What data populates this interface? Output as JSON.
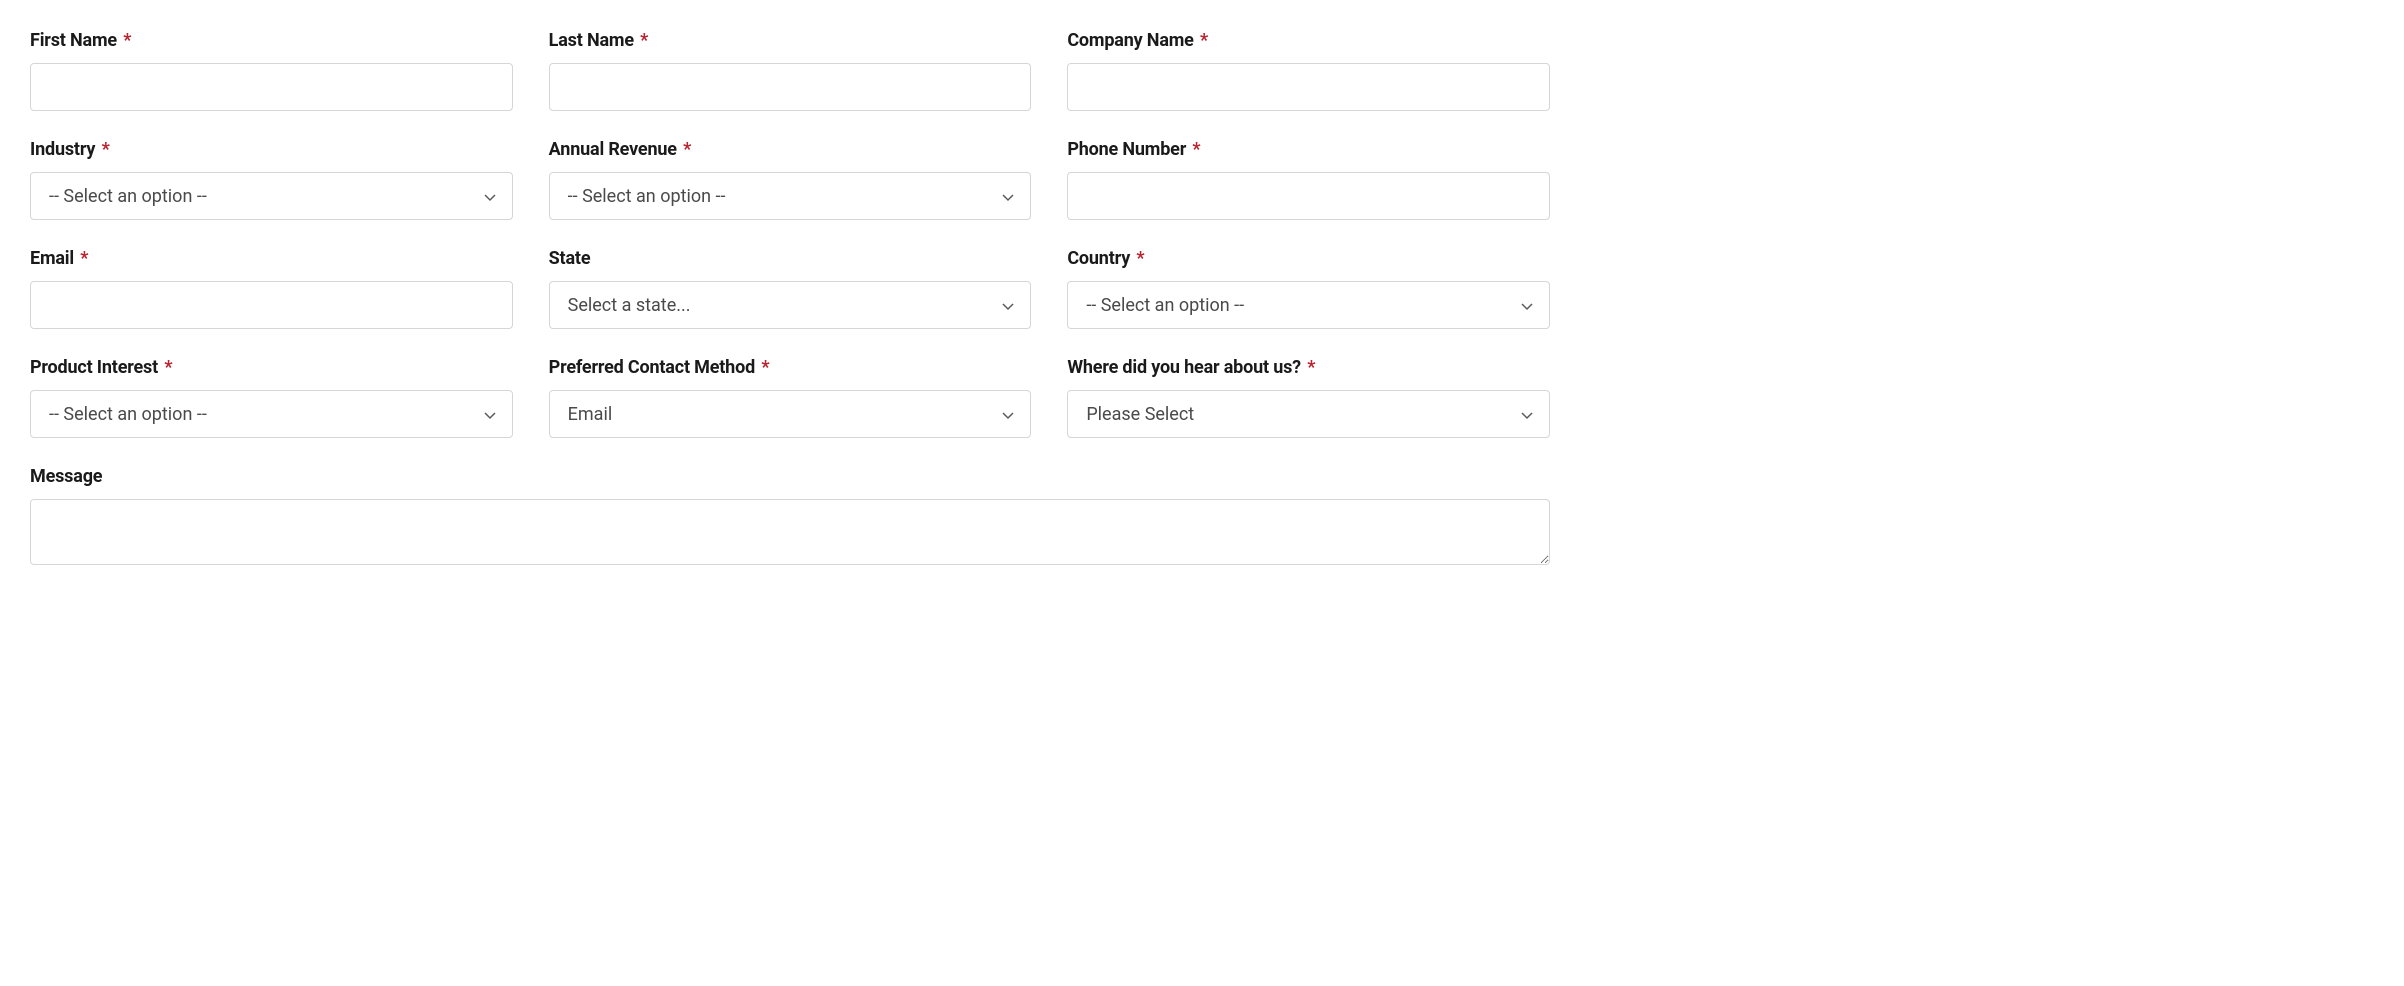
{
  "form": {
    "first_name": {
      "label": "First Name",
      "required": true,
      "value": ""
    },
    "last_name": {
      "label": "Last Name",
      "required": true,
      "value": ""
    },
    "company_name": {
      "label": "Company Name",
      "required": true,
      "value": ""
    },
    "industry": {
      "label": "Industry",
      "required": true,
      "selected": "-- Select an option --"
    },
    "annual_revenue": {
      "label": "Annual Revenue",
      "required": true,
      "selected": "-- Select an option --"
    },
    "phone_number": {
      "label": "Phone Number",
      "required": true,
      "value": ""
    },
    "email": {
      "label": "Email",
      "required": true,
      "value": ""
    },
    "state": {
      "label": "State",
      "required": false,
      "selected": "Select a state..."
    },
    "country": {
      "label": "Country",
      "required": true,
      "selected": "-- Select an option --"
    },
    "product_interest": {
      "label": "Product Interest",
      "required": true,
      "selected": "-- Select an option --"
    },
    "preferred_contact_method": {
      "label": "Preferred Contact Method",
      "required": true,
      "selected": "Email"
    },
    "hear_about_us": {
      "label": "Where did you hear about us?",
      "required": true,
      "selected": "Please Select"
    },
    "message": {
      "label": "Message",
      "required": false,
      "value": ""
    }
  },
  "required_marker": "*"
}
